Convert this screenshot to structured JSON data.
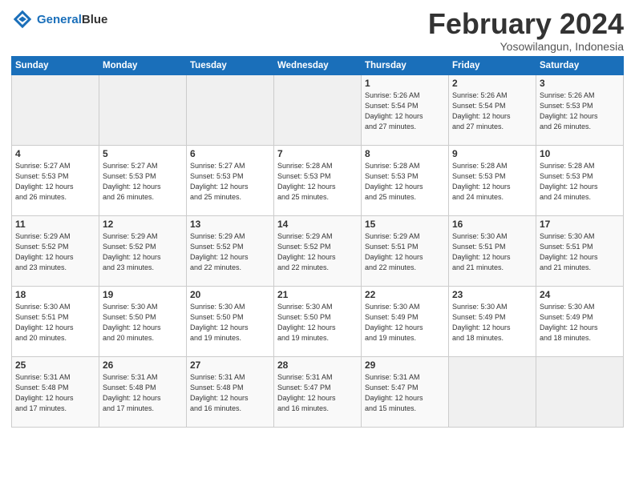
{
  "logo": {
    "line1": "General",
    "line2": "Blue"
  },
  "title": "February 2024",
  "subtitle": "Yosowilangun, Indonesia",
  "days_of_week": [
    "Sunday",
    "Monday",
    "Tuesday",
    "Wednesday",
    "Thursday",
    "Friday",
    "Saturday"
  ],
  "weeks": [
    [
      {
        "day": "",
        "info": ""
      },
      {
        "day": "",
        "info": ""
      },
      {
        "day": "",
        "info": ""
      },
      {
        "day": "",
        "info": ""
      },
      {
        "day": "1",
        "info": "Sunrise: 5:26 AM\nSunset: 5:54 PM\nDaylight: 12 hours\nand 27 minutes."
      },
      {
        "day": "2",
        "info": "Sunrise: 5:26 AM\nSunset: 5:54 PM\nDaylight: 12 hours\nand 27 minutes."
      },
      {
        "day": "3",
        "info": "Sunrise: 5:26 AM\nSunset: 5:53 PM\nDaylight: 12 hours\nand 26 minutes."
      }
    ],
    [
      {
        "day": "4",
        "info": "Sunrise: 5:27 AM\nSunset: 5:53 PM\nDaylight: 12 hours\nand 26 minutes."
      },
      {
        "day": "5",
        "info": "Sunrise: 5:27 AM\nSunset: 5:53 PM\nDaylight: 12 hours\nand 26 minutes."
      },
      {
        "day": "6",
        "info": "Sunrise: 5:27 AM\nSunset: 5:53 PM\nDaylight: 12 hours\nand 25 minutes."
      },
      {
        "day": "7",
        "info": "Sunrise: 5:28 AM\nSunset: 5:53 PM\nDaylight: 12 hours\nand 25 minutes."
      },
      {
        "day": "8",
        "info": "Sunrise: 5:28 AM\nSunset: 5:53 PM\nDaylight: 12 hours\nand 25 minutes."
      },
      {
        "day": "9",
        "info": "Sunrise: 5:28 AM\nSunset: 5:53 PM\nDaylight: 12 hours\nand 24 minutes."
      },
      {
        "day": "10",
        "info": "Sunrise: 5:28 AM\nSunset: 5:53 PM\nDaylight: 12 hours\nand 24 minutes."
      }
    ],
    [
      {
        "day": "11",
        "info": "Sunrise: 5:29 AM\nSunset: 5:52 PM\nDaylight: 12 hours\nand 23 minutes."
      },
      {
        "day": "12",
        "info": "Sunrise: 5:29 AM\nSunset: 5:52 PM\nDaylight: 12 hours\nand 23 minutes."
      },
      {
        "day": "13",
        "info": "Sunrise: 5:29 AM\nSunset: 5:52 PM\nDaylight: 12 hours\nand 22 minutes."
      },
      {
        "day": "14",
        "info": "Sunrise: 5:29 AM\nSunset: 5:52 PM\nDaylight: 12 hours\nand 22 minutes."
      },
      {
        "day": "15",
        "info": "Sunrise: 5:29 AM\nSunset: 5:51 PM\nDaylight: 12 hours\nand 22 minutes."
      },
      {
        "day": "16",
        "info": "Sunrise: 5:30 AM\nSunset: 5:51 PM\nDaylight: 12 hours\nand 21 minutes."
      },
      {
        "day": "17",
        "info": "Sunrise: 5:30 AM\nSunset: 5:51 PM\nDaylight: 12 hours\nand 21 minutes."
      }
    ],
    [
      {
        "day": "18",
        "info": "Sunrise: 5:30 AM\nSunset: 5:51 PM\nDaylight: 12 hours\nand 20 minutes."
      },
      {
        "day": "19",
        "info": "Sunrise: 5:30 AM\nSunset: 5:50 PM\nDaylight: 12 hours\nand 20 minutes."
      },
      {
        "day": "20",
        "info": "Sunrise: 5:30 AM\nSunset: 5:50 PM\nDaylight: 12 hours\nand 19 minutes."
      },
      {
        "day": "21",
        "info": "Sunrise: 5:30 AM\nSunset: 5:50 PM\nDaylight: 12 hours\nand 19 minutes."
      },
      {
        "day": "22",
        "info": "Sunrise: 5:30 AM\nSunset: 5:49 PM\nDaylight: 12 hours\nand 19 minutes."
      },
      {
        "day": "23",
        "info": "Sunrise: 5:30 AM\nSunset: 5:49 PM\nDaylight: 12 hours\nand 18 minutes."
      },
      {
        "day": "24",
        "info": "Sunrise: 5:30 AM\nSunset: 5:49 PM\nDaylight: 12 hours\nand 18 minutes."
      }
    ],
    [
      {
        "day": "25",
        "info": "Sunrise: 5:31 AM\nSunset: 5:48 PM\nDaylight: 12 hours\nand 17 minutes."
      },
      {
        "day": "26",
        "info": "Sunrise: 5:31 AM\nSunset: 5:48 PM\nDaylight: 12 hours\nand 17 minutes."
      },
      {
        "day": "27",
        "info": "Sunrise: 5:31 AM\nSunset: 5:48 PM\nDaylight: 12 hours\nand 16 minutes."
      },
      {
        "day": "28",
        "info": "Sunrise: 5:31 AM\nSunset: 5:47 PM\nDaylight: 12 hours\nand 16 minutes."
      },
      {
        "day": "29",
        "info": "Sunrise: 5:31 AM\nSunset: 5:47 PM\nDaylight: 12 hours\nand 15 minutes."
      },
      {
        "day": "",
        "info": ""
      },
      {
        "day": "",
        "info": ""
      }
    ]
  ]
}
